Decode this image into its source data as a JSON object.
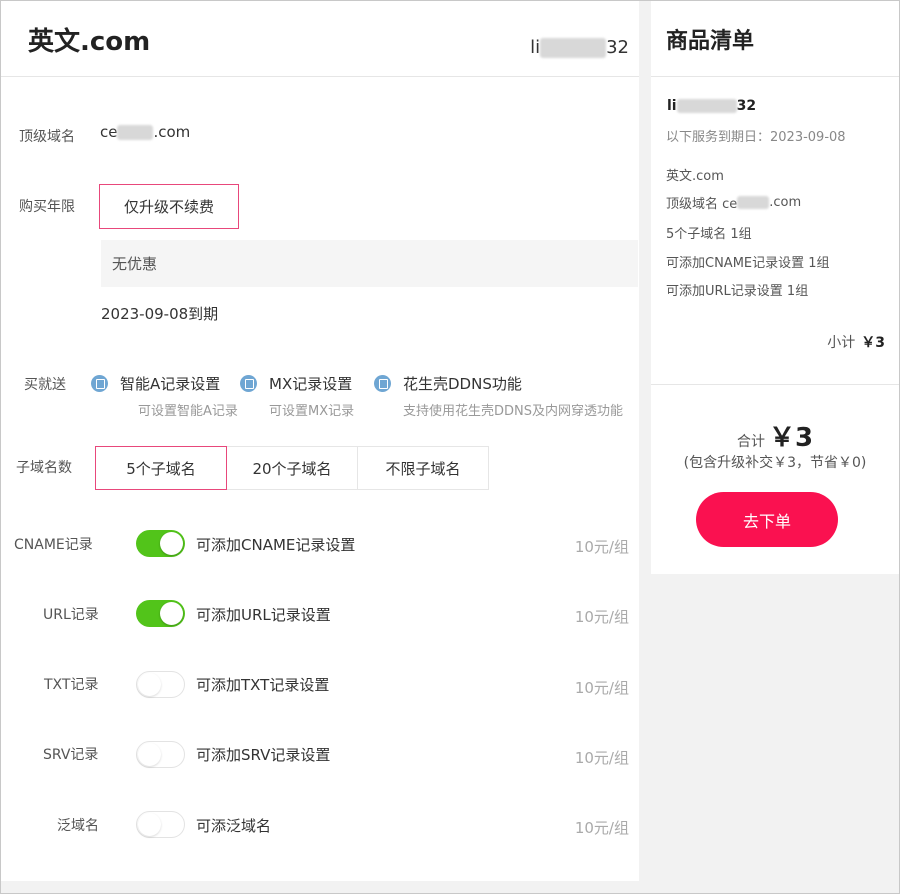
{
  "left": {
    "brand": "英文.com",
    "user_prefix": "li",
    "user_suffix": "32",
    "domain_label": "顶级域名",
    "domain_prefix": "ce",
    "domain_suffix": ".com",
    "period_label": "购买年限",
    "period_option": "仅升级不续费",
    "promo": "无优惠",
    "expire": "2023-09-08到期",
    "gift_label": "买就送",
    "gifts": [
      {
        "title": "智能A记录设置",
        "sub": "可设置智能A记录"
      },
      {
        "title": "MX记录设置",
        "sub": "可设置MX记录"
      },
      {
        "title": "花生壳DDNS功能",
        "sub": "支持使用花生壳DDNS及内网穿透功能"
      }
    ],
    "subdomain_label": "子域名数",
    "subdomain_options": [
      "5个子域名",
      "20个子域名",
      "不限子域名"
    ],
    "records": [
      {
        "label": "CNAME记录",
        "desc": "可添加CNAME记录设置",
        "price": "10元/组",
        "on": true
      },
      {
        "label": "URL记录",
        "desc": "可添加URL记录设置",
        "price": "10元/组",
        "on": true
      },
      {
        "label": "TXT记录",
        "desc": "可添加TXT记录设置",
        "price": "10元/组",
        "on": false
      },
      {
        "label": "SRV记录",
        "desc": "可添加SRV记录设置",
        "price": "10元/组",
        "on": false
      },
      {
        "label": "泛域名",
        "desc": "可添泛域名",
        "price": "10元/组",
        "on": false
      }
    ]
  },
  "right": {
    "title": "商品清单",
    "user_prefix": "li",
    "user_suffix": "32",
    "service_date": "以下服务到期日：2023-09-08",
    "items": [
      "英文.com",
      "顶级域名 ce",
      "5个子域名 1组",
      "可添加CNAME记录设置 1组",
      "可添加URL记录设置 1组"
    ],
    "domain_suffix": ".com",
    "subtotal_label": "小计",
    "subtotal_value": "￥3",
    "total_label": "合计",
    "total_value": "￥3",
    "note": "(包含升级补交￥3，节省￥0)",
    "order_button": "去下单"
  },
  "colors": {
    "accent": "#fa1150",
    "toggle_on": "#52c41a",
    "active_border": "#e8477b",
    "gift_icon": "#6fa6d3"
  }
}
